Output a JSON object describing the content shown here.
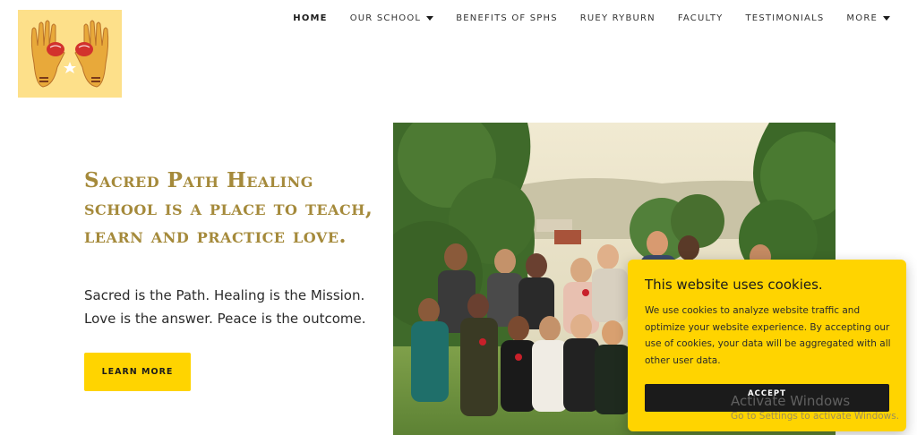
{
  "logo": {
    "icon": "hands-heart-logo"
  },
  "nav": {
    "items": [
      {
        "label": "HOME",
        "active": true,
        "dropdown": false
      },
      {
        "label": "OUR SCHOOL",
        "dropdown": true
      },
      {
        "label": "BENEFITS OF SPHS",
        "dropdown": false
      },
      {
        "label": "RUEY RYBURN",
        "dropdown": false
      },
      {
        "label": "FACULTY",
        "dropdown": false
      },
      {
        "label": "TESTIMONIALS",
        "dropdown": false
      },
      {
        "label": "MORE",
        "dropdown": true
      }
    ]
  },
  "hero": {
    "heading": "Sacred Path Healing school is a place to teach, learn and practice love.",
    "subtext": "Sacred is the Path. Healing is the Mission. Love is the answer. Peace is the outcome.",
    "button_label": "LEARN MORE"
  },
  "cookie": {
    "title": "This website uses cookies.",
    "body": "We use cookies to analyze website traffic and optimize your website experience. By accepting our use of cookies, your data will be aggregated with all other user data.",
    "accept_label": "ACCEPT"
  },
  "watermark": {
    "title": "Activate Windows",
    "subtitle": "Go to Settings to activate Windows."
  },
  "colors": {
    "accent": "#ffd400",
    "heading": "#a58a3b",
    "logo_bg": "#fde08a"
  }
}
